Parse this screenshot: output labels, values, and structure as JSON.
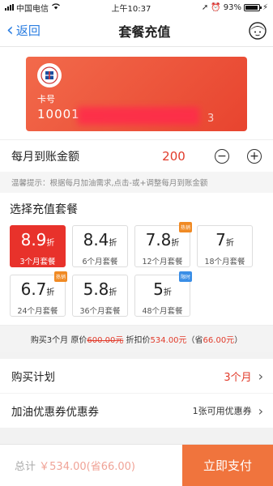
{
  "status_bar": {
    "carrier": "中国电信",
    "time": "上午10:37",
    "battery": "93%",
    "battery_level": 0.93
  },
  "nav": {
    "back_label": "返回",
    "title": "套餐充值"
  },
  "card": {
    "label": "卡号",
    "number_prefix": "10001",
    "number_suffix": "3"
  },
  "amount": {
    "label": "每月到账金额",
    "value": "200",
    "minus": "−",
    "plus": "+"
  },
  "hint": "温馨提示：根据每月加油需求,点击-或+调整每月到账金额",
  "packages": {
    "title": "选择充值套餐",
    "items": [
      {
        "discount": "8.9",
        "unit": "折",
        "desc": "3个月套餐",
        "tag": "",
        "active": true
      },
      {
        "discount": "8.4",
        "unit": "折",
        "desc": "6个月套餐",
        "tag": "",
        "active": false
      },
      {
        "discount": "7.8",
        "unit": "折",
        "desc": "12个月套餐",
        "tag": "热销",
        "active": false
      },
      {
        "discount": "7",
        "unit": "折",
        "desc": "18个月套餐",
        "tag": "",
        "active": false
      },
      {
        "discount": "6.7",
        "unit": "折",
        "desc": "24个月套餐",
        "tag": "热销",
        "active": false
      },
      {
        "discount": "5.8",
        "unit": "折",
        "desc": "36个月套餐",
        "tag": "",
        "active": false
      },
      {
        "discount": "5",
        "unit": "折",
        "desc": "48个月套餐",
        "tag": "限时",
        "active": false
      }
    ]
  },
  "summary": {
    "prefix": "购买3个月 原价",
    "original": "600.00元",
    "mid": " 折扣价",
    "discounted": "534.00元",
    "paren_open": "（省",
    "saved": "66.00元",
    "paren_close": "）"
  },
  "plan": {
    "label": "购买计划",
    "value": "3个月"
  },
  "coupon": {
    "label": "加油优惠券优惠券",
    "value": "1张可用优惠券"
  },
  "footer": {
    "total_label": "总计",
    "total_amount": "￥534.00(省66.00)",
    "pay_label": "立即支付"
  },
  "colors": {
    "accent": "#e8322b",
    "link": "#2a7de1",
    "tag_hot": "#f08a24",
    "tag_limited": "#3a8ee6"
  }
}
